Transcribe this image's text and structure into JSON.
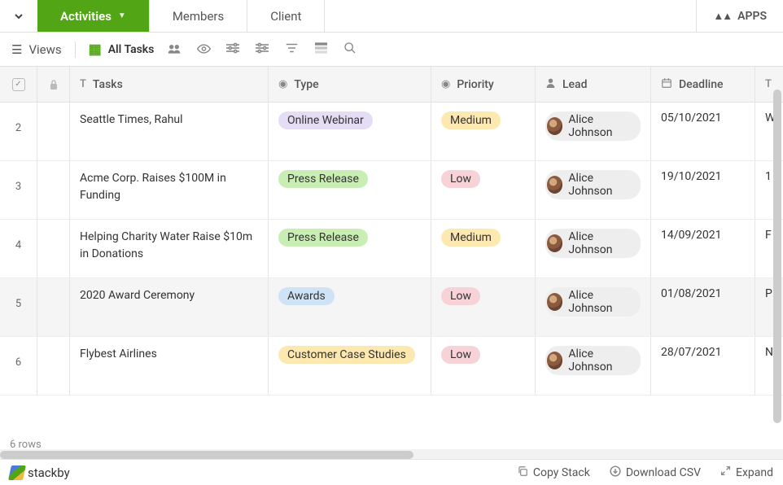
{
  "tabs": {
    "activities": "Activities",
    "members": "Members",
    "client": "Client"
  },
  "apps_label": "APPS",
  "toolbar": {
    "views": "Views",
    "all_tasks": "All Tasks"
  },
  "columns": {
    "tasks": "Tasks",
    "type": "Type",
    "priority": "Priority",
    "lead": "Lead",
    "deadline": "Deadline",
    "extra": "T"
  },
  "rows": [
    {
      "num": "2",
      "task": "Seattle Times, Rahul",
      "type": "Online Webinar",
      "type_class": "pill-webinar",
      "priority": "Medium",
      "priority_class": "pill-medium",
      "lead": "Alice Johnson",
      "deadline": "05/10/2021",
      "extra": "W",
      "selected": false
    },
    {
      "num": "3",
      "task": "Acme Corp. Raises $100M in Funding",
      "type": "Press Release",
      "type_class": "pill-press",
      "priority": "Low",
      "priority_class": "pill-low",
      "lead": "Alice Johnson",
      "deadline": "19/10/2021",
      "extra": "1",
      "selected": false
    },
    {
      "num": "4",
      "task": "Helping Charity Water Raise $10m in Donations",
      "type": "Press Release",
      "type_class": "pill-press",
      "priority": "Medium",
      "priority_class": "pill-medium",
      "lead": "Alice Johnson",
      "deadline": "14/09/2021",
      "extra": "F",
      "selected": false
    },
    {
      "num": "5",
      "task": "2020 Award Ceremony",
      "type": "Awards",
      "type_class": "pill-awards",
      "priority": "Low",
      "priority_class": "pill-low",
      "lead": "Alice Johnson",
      "deadline": "01/08/2021",
      "extra": "P",
      "selected": true
    },
    {
      "num": "6",
      "task": "Flybest Airlines",
      "type": "Customer Case Studies",
      "type_class": "pill-customer",
      "priority": "Low",
      "priority_class": "pill-low",
      "lead": "Alice Johnson",
      "deadline": "28/07/2021",
      "extra": "N",
      "selected": false
    }
  ],
  "row_count": "6 rows",
  "bottom": {
    "brand": "stackby",
    "copy": "Copy Stack",
    "download": "Download CSV",
    "expand": "Expand"
  }
}
